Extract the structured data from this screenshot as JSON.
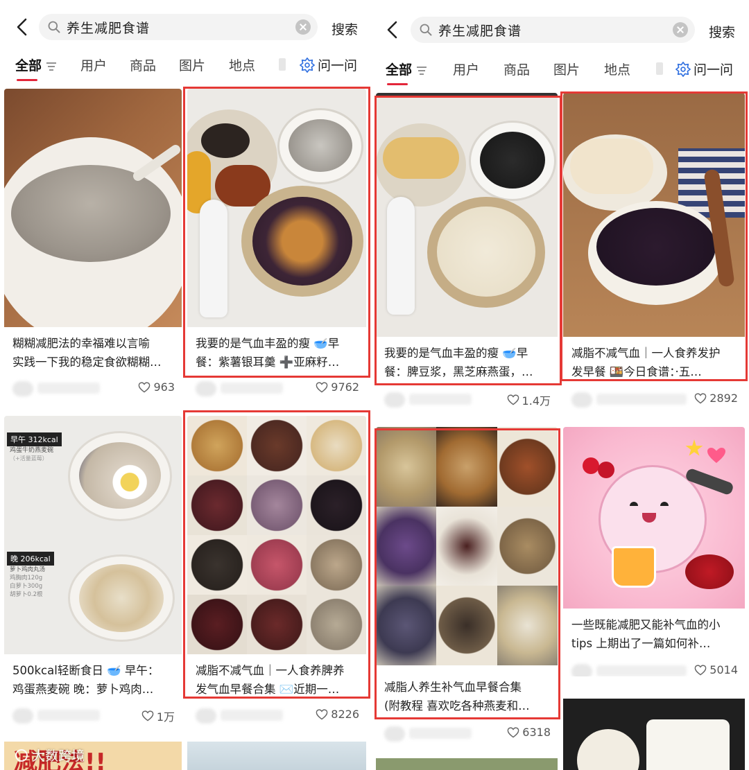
{
  "search": {
    "query": "养生减肥食谱",
    "button_label": "搜索"
  },
  "tabs": [
    "全部",
    "用户",
    "商品",
    "图片",
    "地点"
  ],
  "ask_label": "问一问",
  "colors": {
    "accent": "#e3263a",
    "highlight": "#e53935"
  },
  "left_screen": {
    "cards": [
      {
        "title": "糊糊减肥法的幸福难以言喻\n实践一下我的稳定食欲糊糊…",
        "likes": "963"
      },
      {
        "title": "我要的是气血丰盈的瘦 🥣早\n餐：紫薯银耳羹 ➕亚麻籽…",
        "likes": "9762"
      },
      {
        "title": "500kcal轻断食日 🥣 早午：\n鸡蛋燕麦碗 晚：萝卜鸡肉…",
        "likes": "1万",
        "img_labels": {
          "lunch": "早午",
          "lunch_kcal": "312kcal",
          "lunch_sub": "鸡蛋牛奶燕麦碗",
          "lunch_sub2": "（+活量蓝莓）",
          "dinner": "晚",
          "dinner_kcal": "206kcal",
          "dinner_sub": "萝卜鸡肉丸汤",
          "dinner_items": [
            "鸡胸肉120g",
            "白萝卜300g",
            "胡萝卜0.2根"
          ]
        }
      },
      {
        "title": "减脂不减气血｜一人食养脾养\n发气血早餐合集 ✉️近期一…",
        "likes": "8226"
      },
      {
        "ad_text": "减肥法!!"
      }
    ],
    "watermark": "大数跨境"
  },
  "right_screen": {
    "cards": [
      {
        "title": "我要的是气血丰盈的瘦 🥣早\n餐：脾豆浆，黑芝麻燕蛋，…",
        "likes": "1.4万"
      },
      {
        "title": "减脂不减气血｜一人食养发护\n发早餐 🍱今日食谱：·五…",
        "likes": "2892"
      },
      {
        "title": "减脂人养生补气血早餐合集\n(附教程 喜欢吃各种燕麦和…",
        "likes": "6318"
      },
      {
        "title": "一些既能减肥又能补气血的小\ntips 上期出了一篇如何补…",
        "likes": "5014"
      }
    ]
  }
}
